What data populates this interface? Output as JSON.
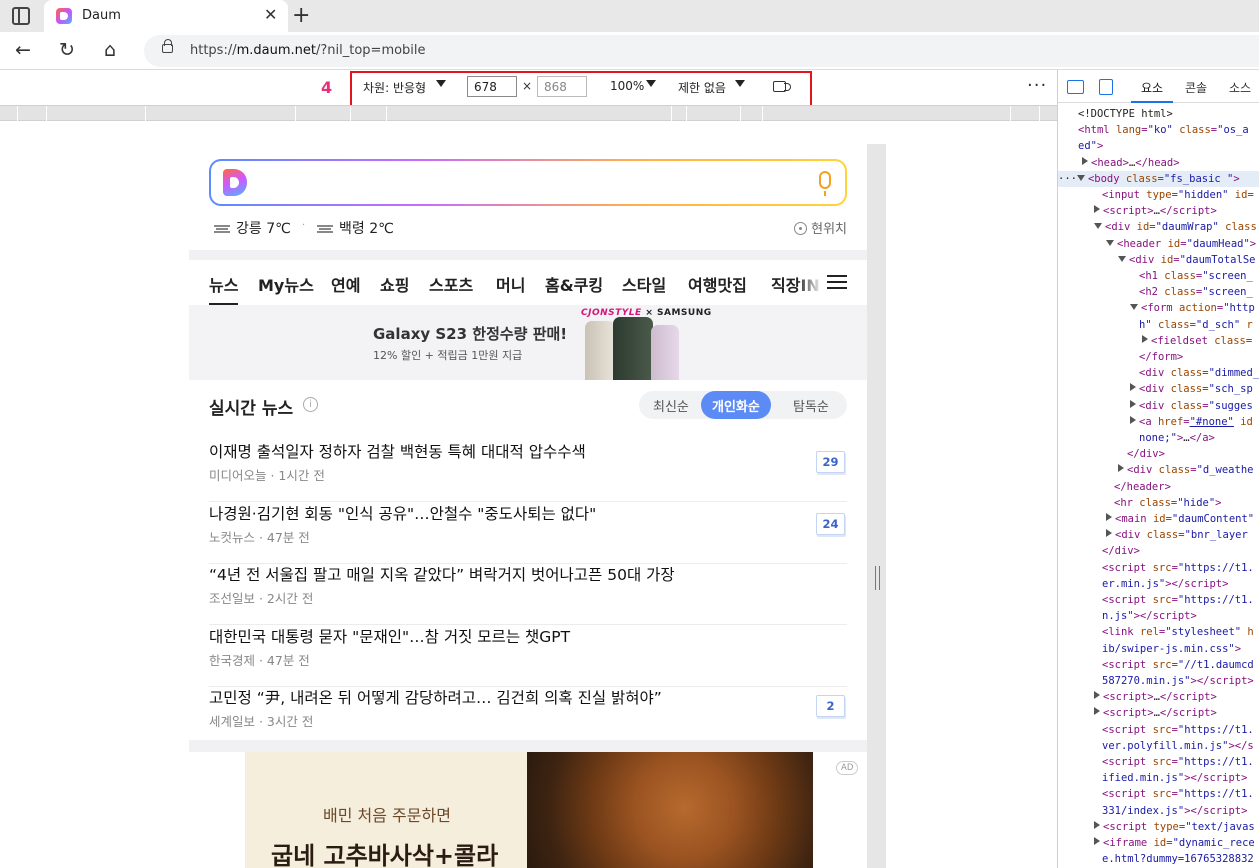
{
  "browser": {
    "tab_title": "Daum",
    "url_prefix": "https://",
    "url_host": "m.daum.net",
    "url_rest": "/?nil_top=mobile"
  },
  "device_toolbar": {
    "step_number": "4",
    "dimension_label": "차원: 반응형",
    "width": "678",
    "height": "868",
    "times": "×",
    "zoom": "100%",
    "throttle": "제한 없음",
    "more": "⋮"
  },
  "search": {
    "placeholder": ""
  },
  "weather": {
    "city1": "강릉 7℃",
    "city2": "백령 2℃",
    "sep": "·",
    "my_location": "현위치"
  },
  "nav_tabs": [
    "뉴스",
    "My뉴스",
    "연예",
    "쇼핑",
    "스포츠",
    "머니",
    "홈&쿠킹",
    "스타일",
    "여행맛집",
    "직장IN"
  ],
  "banner": {
    "title": "Galaxy S23 한정수량 판매!",
    "subtitle": "12% 할인 + 적립금 1만원 지급",
    "brand_cj": "CJONSTYLE",
    "brand_x": "×",
    "brand_samsung": "SAMSUNG"
  },
  "realtime_news": {
    "title": "실시간 뉴스",
    "info": "i",
    "sort_latest": "최신순",
    "sort_personal": "개인화순",
    "sort_explore": "탐독순",
    "items": [
      {
        "headline": "이재명 출석일자 정하자 검찰 백현동 특혜 대대적 압수수색",
        "meta": "미디어오늘 · 1시간 전",
        "count": "29"
      },
      {
        "headline": "나경원·김기현 회동 \"인식 공유\"…안철수 \"중도사퇴는 없다\"",
        "meta": "노컷뉴스 · 47분 전",
        "count": "24"
      },
      {
        "headline": "“4년 전 서울집 팔고 매일 지옥 같았다” 벼락거지 벗어나고픈 50대 가장",
        "meta": "조선일보 · 2시간 전",
        "count": ""
      },
      {
        "headline": "대한민국 대통령 묻자 \"문재인\"…참 거짓 모르는 챗GPT",
        "meta": "한국경제 · 47분 전",
        "count": ""
      },
      {
        "headline": "고민정 “尹, 내려온 뒤 어떻게 감당하려고… 김건희 의혹 진실 밝혀야”",
        "meta": "세계일보 · 3시간 전",
        "count": "2"
      }
    ]
  },
  "ad": {
    "line1": "배민 처음 주문하면",
    "line2": "굽네 고추바사삭+콜라",
    "tag": "AD"
  },
  "devtools": {
    "tab_elements": "요소",
    "tab_console": "콘솔",
    "tab_sources": "소스"
  },
  "colors": {
    "accent_blue": "#5c8bf5",
    "highlight_red": "#e3141b",
    "step_pink": "#e0317a"
  }
}
